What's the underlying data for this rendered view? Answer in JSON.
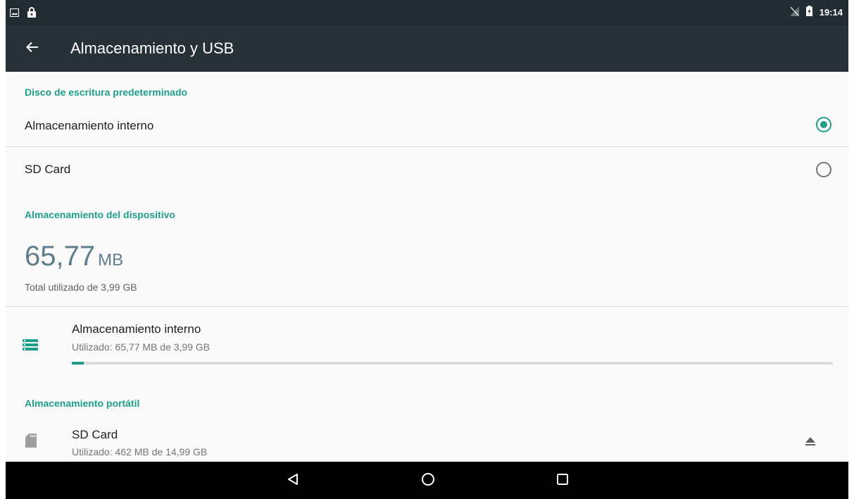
{
  "status_bar": {
    "time": "19:14",
    "left_icons": [
      "image-icon",
      "lock-icon"
    ],
    "right_icons": [
      "no-sim-icon",
      "battery-charging-icon"
    ]
  },
  "action_bar": {
    "title": "Almacenamiento y USB",
    "back_icon": "arrow-back-icon"
  },
  "default_write_disk": {
    "header": "Disco de escritura predeterminado",
    "options": [
      {
        "label": "Almacenamiento interno",
        "selected": true
      },
      {
        "label": "SD Card",
        "selected": false
      }
    ]
  },
  "device_storage": {
    "header": "Almacenamiento del dispositivo",
    "used_value": "65,77",
    "used_unit": "MB",
    "total_text": "Total utilizado de 3,99 GB",
    "volumes": [
      {
        "title": "Almacenamiento interno",
        "subtitle": "Utilizado: 65,77 MB de 3,99 GB",
        "icon": "storage-icon",
        "used_fraction": 0.0161
      }
    ]
  },
  "portable_storage": {
    "header": "Almacenamiento portátil",
    "volumes": [
      {
        "title": "SD Card",
        "subtitle": "Utilizado: 462 MB de 14,99 GB",
        "icon": "sd-card-icon",
        "action_icon": "eject-icon"
      }
    ]
  },
  "nav_bar": {
    "buttons": [
      "back-triangle-icon",
      "home-circle-icon",
      "recents-square-icon"
    ]
  },
  "colors": {
    "accent": "#1e9e8a",
    "toolbar": "#263238",
    "status_bar": "#202b32",
    "big_number": "#5f7d8a"
  }
}
